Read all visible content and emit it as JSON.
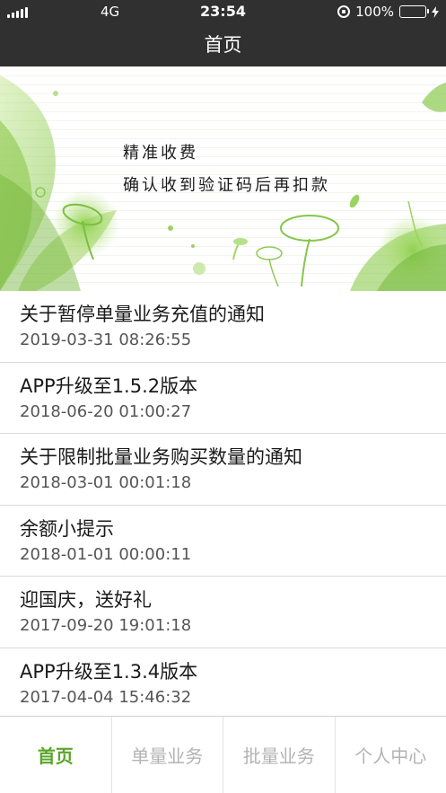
{
  "status_bar": {
    "network": "4G",
    "time": "23:54",
    "battery_percent": "100%",
    "battery_level": 1.0,
    "battery_color": "#4cd964"
  },
  "nav": {
    "title": "首页"
  },
  "banner": {
    "line1": "精准收费",
    "line2": "确认收到验证码后再扣款"
  },
  "notices": [
    {
      "title": "关于暂停单量业务充值的通知",
      "time": "2019-03-31 08:26:55"
    },
    {
      "title": "APP升级至1.5.2版本",
      "time": "2018-06-20 01:00:27"
    },
    {
      "title": "关于限制批量业务购买数量的通知",
      "time": "2018-03-01 00:01:18"
    },
    {
      "title": "余额小提示",
      "time": "2018-01-01 00:00:11"
    },
    {
      "title": "迎国庆，送好礼",
      "time": "2017-09-20 19:01:18"
    },
    {
      "title": "APP升级至1.3.4版本",
      "time": "2017-04-04 15:46:32"
    }
  ],
  "tabs": [
    {
      "label": "首页",
      "active": true
    },
    {
      "label": "单量业务",
      "active": false
    },
    {
      "label": "批量业务",
      "active": false
    },
    {
      "label": "个人中心",
      "active": false
    }
  ],
  "colors": {
    "accent": "#5aa52a",
    "header_bg": "#303030",
    "inactive_tab": "#b3b3b3"
  }
}
